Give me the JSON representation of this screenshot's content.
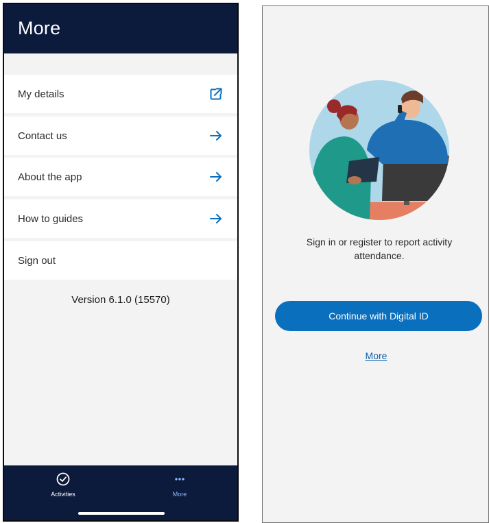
{
  "left_screen": {
    "header": {
      "title": "More"
    },
    "menu": [
      {
        "label": "My details",
        "icon": "external-link-icon"
      },
      {
        "label": "Contact us",
        "icon": "arrow-right-icon"
      },
      {
        "label": "About the app",
        "icon": "arrow-right-icon"
      },
      {
        "label": "How to guides",
        "icon": "arrow-right-icon"
      },
      {
        "label": "Sign out",
        "icon": ""
      }
    ],
    "version": "Version 6.1.0 (15570)",
    "tabs": [
      {
        "label": "Activities",
        "icon": "check-circle-icon",
        "active": false
      },
      {
        "label": "More",
        "icon": "more-dots-icon",
        "active": true
      }
    ]
  },
  "right_screen": {
    "prompt_line1": "Sign in or register to report activity",
    "prompt_line2": "attendance.",
    "cta_label": "Continue with Digital ID",
    "more_link": "More"
  },
  "colors": {
    "navy": "#0c1a3b",
    "accent_blue": "#0a6fbd",
    "active_tab": "#8fb7ff",
    "background": "#f3f3f3"
  }
}
